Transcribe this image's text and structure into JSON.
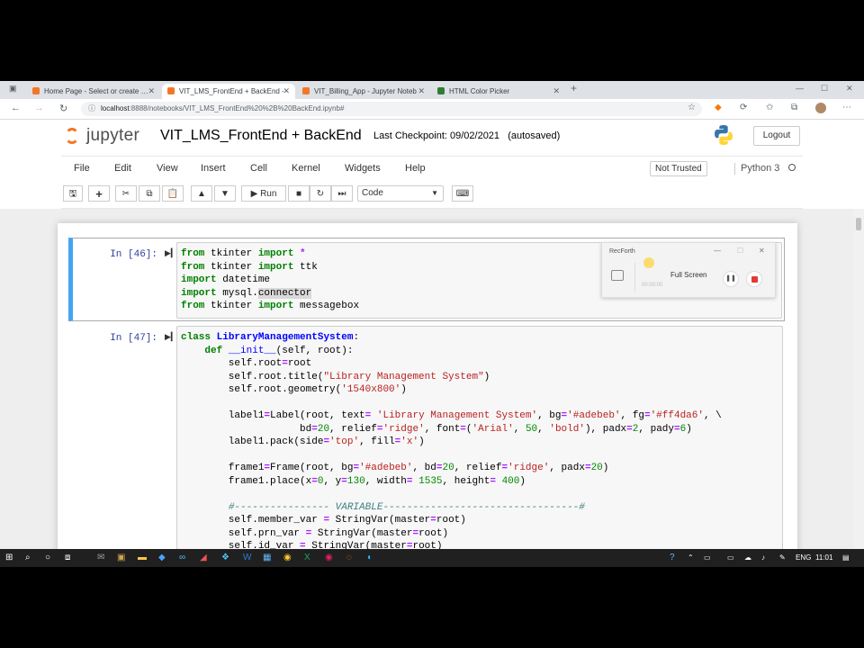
{
  "browser": {
    "tabs": [
      {
        "label": "Home Page - Select or create a n",
        "favicon_color": "#f37726",
        "active": false
      },
      {
        "label": "VIT_LMS_FrontEnd + BackEnd -",
        "favicon_color": "#f37726",
        "active": true
      },
      {
        "label": "VIT_Billing_App - Jupyter Noteb",
        "favicon_color": "#f37726",
        "active": false
      },
      {
        "label": "HTML Color Picker",
        "favicon_color": "#2e7d32",
        "active": false
      }
    ],
    "new_tab": "+",
    "url_host": "localhost",
    "url_path": ":8888/notebooks/VIT_LMS_FrontEnd%20%2B%20BackEnd.ipynb#"
  },
  "jupyter": {
    "logo_text": "jupyter",
    "notebook_title": "VIT_LMS_FrontEnd + BackEnd",
    "checkpoint": "Last Checkpoint: 09/02/2021",
    "autosave": "(autosaved)",
    "logout_label": "Logout",
    "menu": [
      "File",
      "Edit",
      "View",
      "Insert",
      "Cell",
      "Kernel",
      "Widgets",
      "Help"
    ],
    "trust_label": "Not Trusted",
    "kernel_name": "Python 3",
    "run_label": "Run",
    "cell_type": "Code"
  },
  "cells": [
    {
      "prompt": "In [46]:"
    },
    {
      "prompt": "In [47]:"
    }
  ],
  "recorder": {
    "title": "RecForth",
    "mode": "Full Screen",
    "time": "00:00:00"
  },
  "taskbar": {
    "language": "ENG",
    "time": "11:01"
  }
}
